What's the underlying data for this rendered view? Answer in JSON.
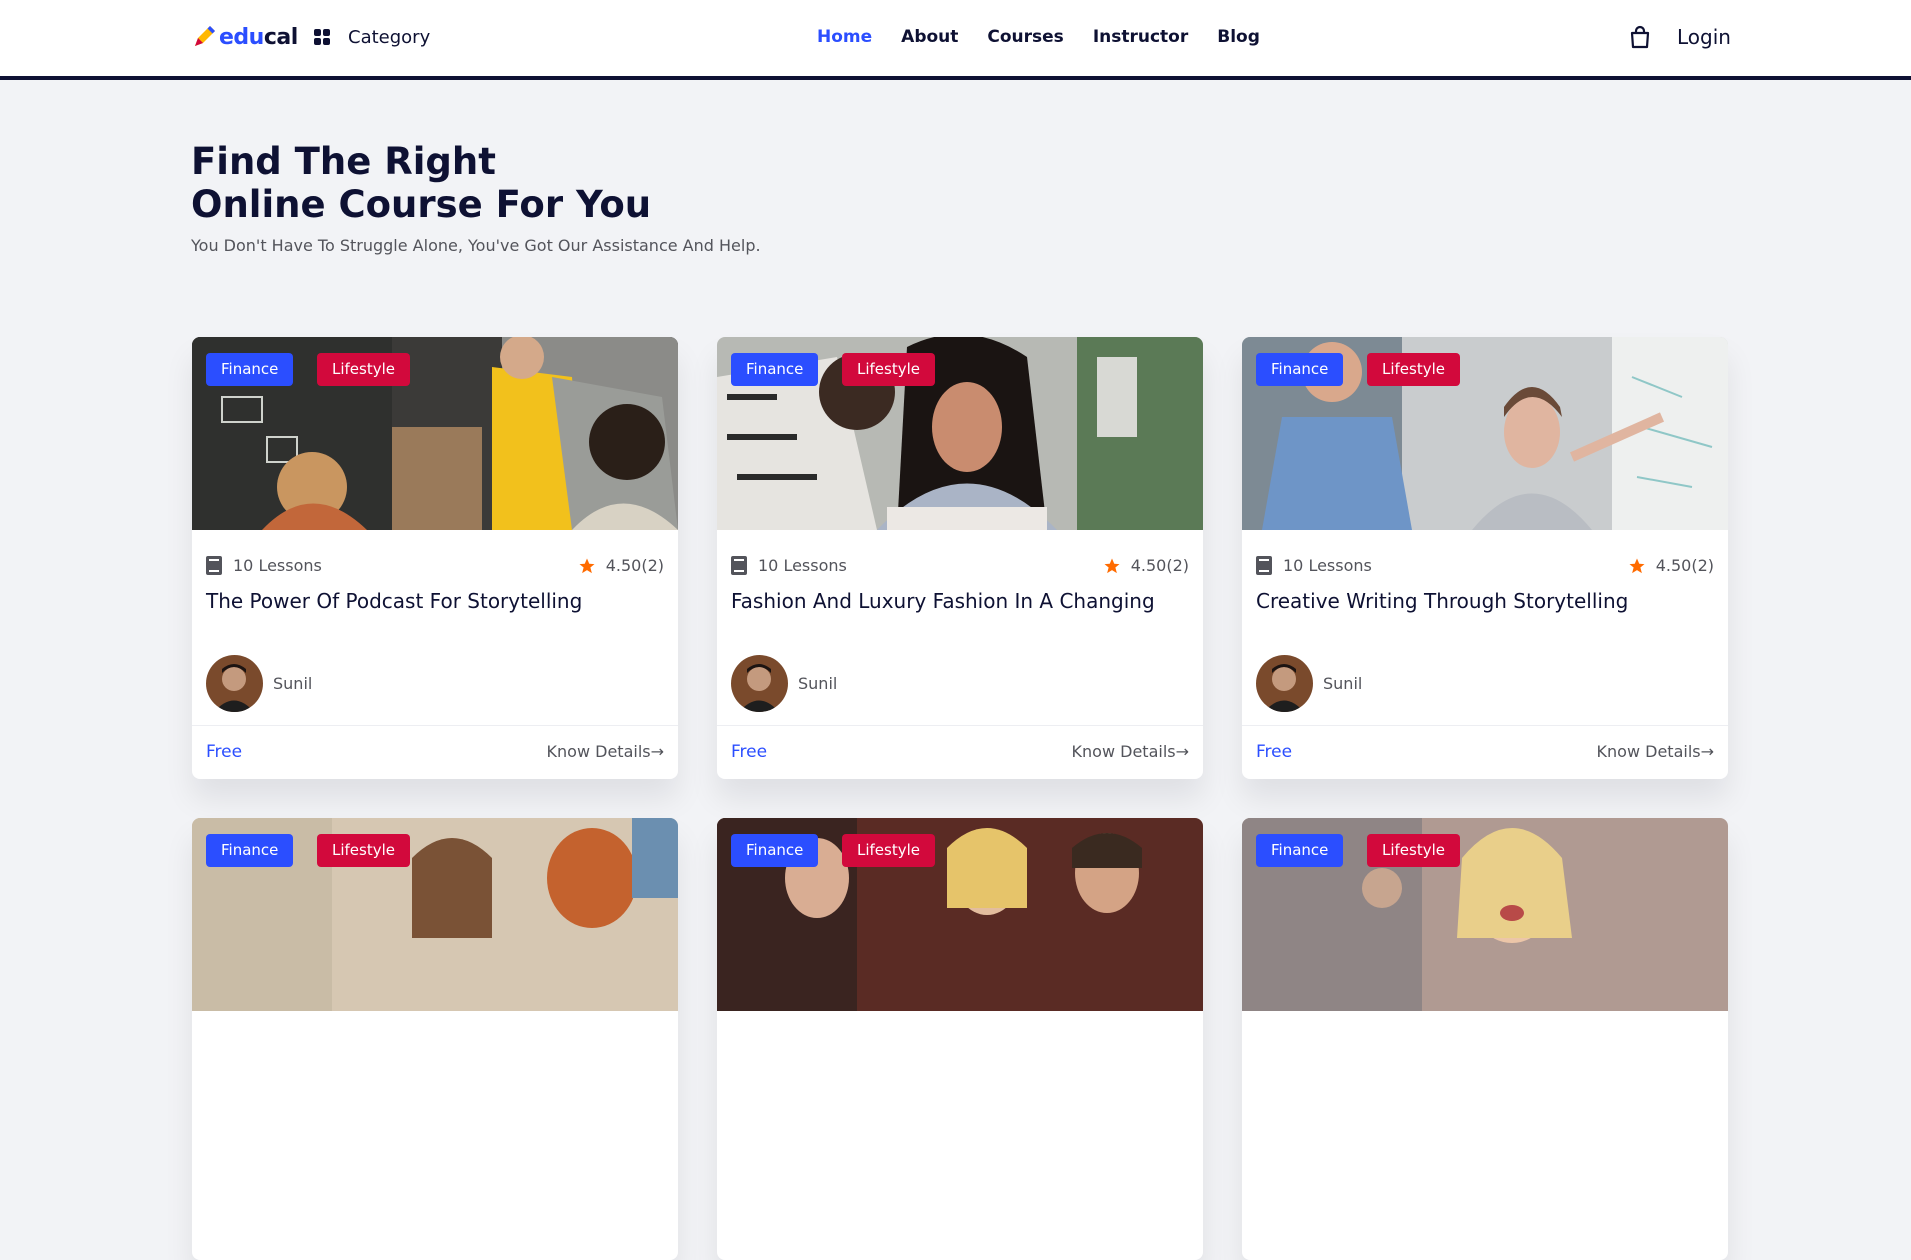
{
  "header": {
    "logo_edu": "edu",
    "logo_cal": "cal",
    "category_label": "Category",
    "nav": [
      "Home",
      "About",
      "Courses",
      "Instructor",
      "Blog"
    ],
    "active_nav": "Home",
    "login_label": "Login"
  },
  "hero": {
    "title_line1": "Find The Right",
    "title_line2": "Online Course For You",
    "subtitle": "You Don't Have To Struggle Alone, You've Got Our Assistance And Help."
  },
  "courses": [
    {
      "tags": [
        "Finance",
        "Lifestyle"
      ],
      "lessons": "10 Lessons",
      "rating": "4.50(2)",
      "title": "The Power Of Podcast For Storytelling",
      "author": "Sunil",
      "price": "Free",
      "details": "Know Details→"
    },
    {
      "tags": [
        "Finance",
        "Lifestyle"
      ],
      "lessons": "10 Lessons",
      "rating": "4.50(2)",
      "title": "Fashion And Luxury Fashion In A Changing",
      "author": "Sunil",
      "price": "Free",
      "details": "Know Details→"
    },
    {
      "tags": [
        "Finance",
        "Lifestyle"
      ],
      "lessons": "10 Lessons",
      "rating": "4.50(2)",
      "title": "Creative Writing Through Storytelling",
      "author": "Sunil",
      "price": "Free",
      "details": "Know Details→"
    },
    {
      "tags": [
        "Finance",
        "Lifestyle"
      ]
    },
    {
      "tags": [
        "Finance",
        "Lifestyle"
      ]
    },
    {
      "tags": [
        "Finance",
        "Lifestyle"
      ]
    }
  ],
  "colors": {
    "brand_blue": "#2b4eff",
    "tag_finance": "#2b4eff",
    "tag_lifestyle": "#d2093c",
    "star": "#ff6b00",
    "heading": "#0e1133",
    "muted_text": "#53545b",
    "page_bg": "#f2f3f6"
  },
  "icons": {
    "logo": "pencil-logo-icon",
    "category": "grid-icon",
    "cart": "shopping-bag-icon",
    "lessons": "book-icon",
    "rating": "star-icon"
  }
}
